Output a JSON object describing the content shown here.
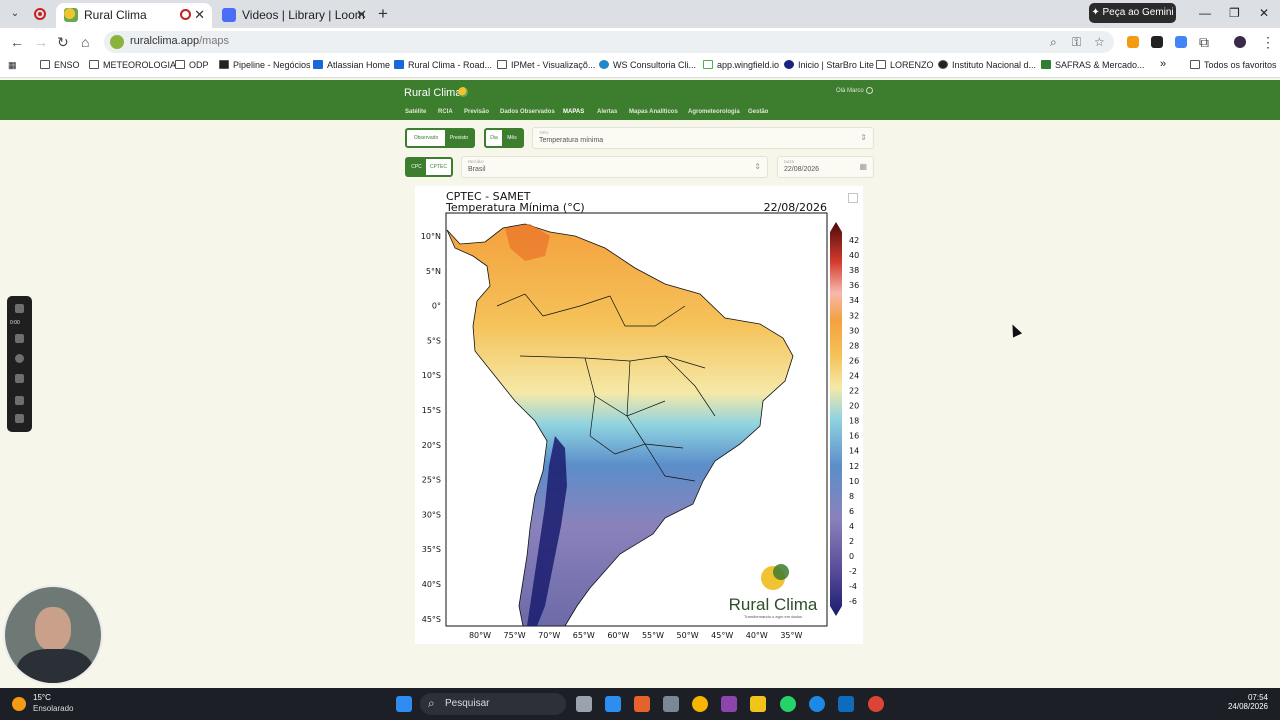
{
  "browser": {
    "tabs": [
      {
        "title": "Rural Clima",
        "active": true
      },
      {
        "title": "Videos | Library | Loom",
        "active": false
      }
    ],
    "gemini_label": "Peça ao Gemini",
    "url_domain": "ruralclima.app",
    "url_path": "/maps",
    "bookmarks": [
      "ENSO",
      "METEOROLOGIA",
      "ODP",
      "Pipeline - Negócios",
      "Atlassian Home",
      "Rural Clima - Road...",
      "IPMet - Visualizaçõ...",
      "WS Consultoria Cli...",
      "app.wingfield.io",
      "Inicio | StarBro Lite",
      "LORENZO",
      "Instituto Nacional d...",
      "SAFRAS & Mercado..."
    ],
    "bookmarks_more": "»",
    "all_favorites": "Todos os favoritos"
  },
  "app": {
    "brand": "Rural Clima",
    "user": "Olá Marco",
    "menu": [
      "Satélite",
      "RCIA",
      "Previsão",
      "Dados Observados",
      "MAPAS",
      "Alertas",
      "Mapas Analíticos",
      "Agrometeorologia",
      "Gestão"
    ],
    "active_menu": "MAPAS",
    "toggle_source": {
      "options": [
        "Observado",
        "Previsto"
      ],
      "selected": "Previsto"
    },
    "toggle_period": {
      "options": [
        "Dia",
        "Mês"
      ],
      "selected": "Mês"
    },
    "tipo": {
      "label": "TIPO",
      "value": "Temperatura mínima"
    },
    "toggle_model": {
      "options": [
        "CPC",
        "CPTEC"
      ],
      "selected": "CPTEC"
    },
    "regiao": {
      "label": "REGIÃO",
      "value": "Brasil"
    },
    "data": {
      "label": "DATA",
      "value": "22/08/2026"
    }
  },
  "map": {
    "title_line1": "CPTEC - SAMET",
    "title_line2": "Temperatura Mínima (°C)",
    "date": "22/08/2026",
    "lat_labels": [
      "10°N",
      "5°N",
      "0°",
      "5°S",
      "10°S",
      "15°S",
      "20°S",
      "25°S",
      "30°S",
      "35°S",
      "40°S",
      "45°S"
    ],
    "lon_labels": [
      "80°W",
      "75°W",
      "70°W",
      "65°W",
      "60°W",
      "55°W",
      "50°W",
      "45°W",
      "40°W",
      "35°W"
    ],
    "colorbar_ticks": [
      "42",
      "40",
      "38",
      "36",
      "34",
      "32",
      "30",
      "28",
      "26",
      "24",
      "22",
      "20",
      "18",
      "16",
      "14",
      "12",
      "10",
      "8",
      "6",
      "4",
      "2",
      "0",
      "-2",
      "-4",
      "-6"
    ],
    "watermark": "Rural Clima",
    "watermark_sub": "Transformando o agro em dados",
    "colors": {
      "warm_orange": "#f4a13d",
      "yellow": "#f5d57a",
      "cyan": "#8fd3e0",
      "blue": "#5b8ec9",
      "purple": "#8a82bb",
      "deep_navy": "#1a1c6e"
    }
  },
  "loom": {
    "time": "0:00"
  },
  "taskbar": {
    "temperature": "15°C",
    "condition": "Ensolarado",
    "search_placeholder": "Pesquisar",
    "time": "07:54",
    "date": "24/08/2026"
  }
}
